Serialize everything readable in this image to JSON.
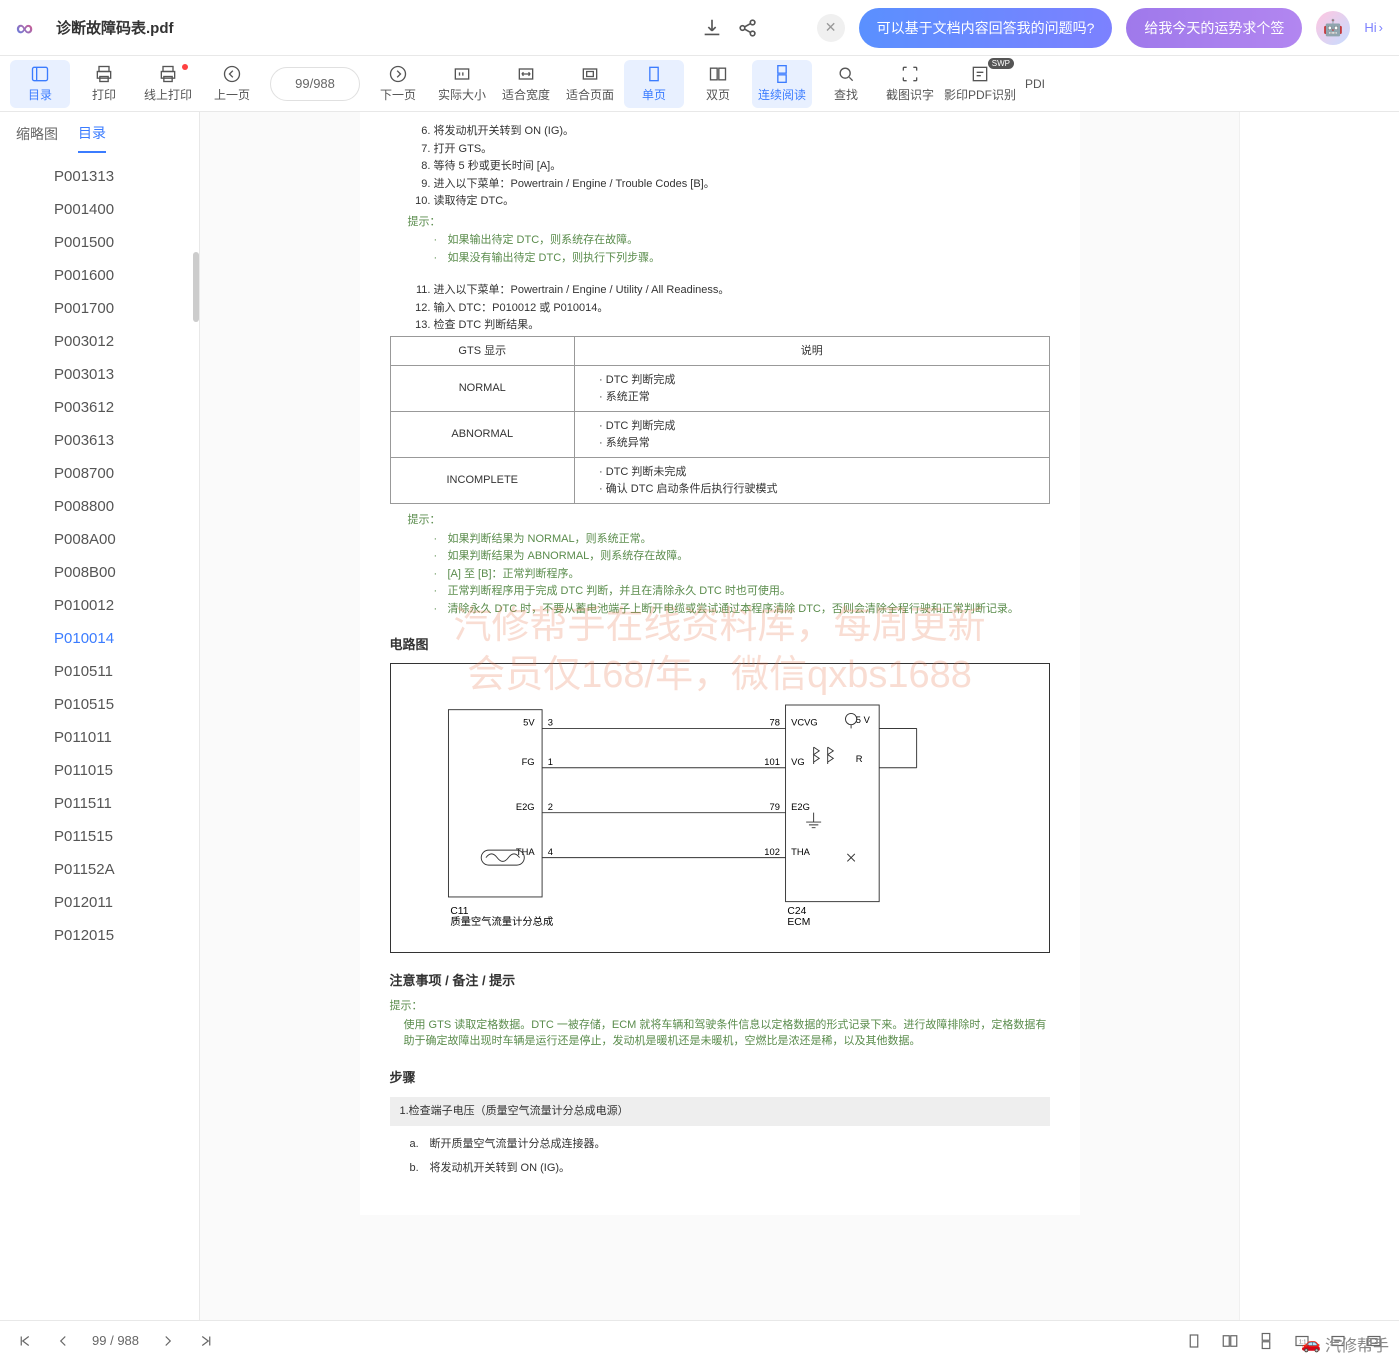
{
  "header": {
    "filename": "诊断故障码表.pdf",
    "pill1": "可以基于文档内容回答我的问题吗?",
    "pill2": "给我今天的运势求个签",
    "hi": "Hi"
  },
  "toolbar": {
    "toc": "目录",
    "print": "打印",
    "online_print": "线上打印",
    "prev": "上一页",
    "page_current": "99",
    "page_sep": " / ",
    "page_total": "988",
    "next": "下一页",
    "actual": "实际大小",
    "fit_width": "适合宽度",
    "fit_page": "适合页面",
    "single": "单页",
    "double": "双页",
    "continuous": "连续阅读",
    "find": "查找",
    "screenshot_ocr": "截图识字",
    "pdf_ocr": "影印PDF识别",
    "pdf_more": "PDI",
    "swp": "SWP"
  },
  "sidebar": {
    "tab_thumb": "缩略图",
    "tab_toc": "目录",
    "items": [
      "P001313",
      "P001400",
      "P001500",
      "P001600",
      "P001700",
      "P003012",
      "P003013",
      "P003612",
      "P003613",
      "P008700",
      "P008800",
      "P008A00",
      "P008B00",
      "P010012",
      "P010014",
      "P010511",
      "P010515",
      "P011011",
      "P011015",
      "P011511",
      "P011515",
      "P01152A",
      "P012011",
      "P012015"
    ],
    "selected_index": 14
  },
  "doc": {
    "pre_lines_start": 6,
    "pre_lines": [
      "将发动机开关转到 ON (IG)。",
      "打开 GTS。",
      "等待 5 秒或更长时间 [A]。",
      "进入以下菜单：Powertrain / Engine / Trouble Codes [B]。",
      "读取待定 DTC。"
    ],
    "hint_label": "提示：",
    "hints1": [
      "如果输出待定 DTC，则系统存在故障。",
      "如果没有输出待定 DTC，则执行下列步骤。"
    ],
    "mid_lines_start": 11,
    "mid_lines": [
      "进入以下菜单：Powertrain / Engine / Utility / All Readiness。",
      "输入 DTC：P010012 或 P010014。",
      "检查 DTC 判断结果。"
    ],
    "table": {
      "head1": "GTS 显示",
      "head2": "说明",
      "rows": [
        {
          "c1": "NORMAL",
          "c2": [
            "DTC 判断完成",
            "系统正常"
          ]
        },
        {
          "c1": "ABNORMAL",
          "c2": [
            "DTC 判断完成",
            "系统异常"
          ]
        },
        {
          "c1": "INCOMPLETE",
          "c2": [
            "DTC 判断未完成",
            "确认 DTC 启动条件后执行行驶模式"
          ]
        }
      ]
    },
    "hints2_label": "提示：",
    "hints2": [
      "如果判断结果为 NORMAL，则系统正常。",
      "如果判断结果为 ABNORMAL，则系统存在故障。",
      "[A] 至 [B]：正常判断程序。",
      "正常判断程序用于完成 DTC 判断，并且在清除永久 DTC 时也可使用。",
      "清除永久 DTC 时，不要从蓄电池端子上断开电缆或尝试通过本程序清除 DTC，否则会清除全程行驶和正常判断记录。"
    ],
    "section_circuit": "电路图",
    "diagram": {
      "left_label": "C11",
      "left_sub": "质量空气流量计分总成",
      "right_label": "C24",
      "right_sub": "ECM",
      "wires": [
        {
          "l": "5V",
          "lp": "3",
          "rp": "78",
          "r": "VCVG",
          "note": "5 V"
        },
        {
          "l": "FG",
          "lp": "1",
          "rp": "101",
          "r": "VG",
          "note": "R"
        },
        {
          "l": "E2G",
          "lp": "2",
          "rp": "79",
          "r": "E2G",
          "note": ""
        },
        {
          "l": "THA",
          "lp": "4",
          "rp": "102",
          "r": "THA",
          "note": ""
        }
      ]
    },
    "watermark_l1": "汽修帮手在线资料库，每周更新",
    "watermark_l2": "会员仅168/年，微信qxbs1688",
    "section_notes": "注意事项 / 备注 / 提示",
    "notes_hint_label": "提示：",
    "notes_hint": "使用 GTS 读取定格数据。DTC 一被存储，ECM 就将车辆和驾驶条件信息以定格数据的形式记录下来。进行故障排除时，定格数据有助于确定故障出现时车辆是运行还是停止，发动机是暖机还是未暖机，空燃比是浓还是稀，以及其他数据。",
    "section_steps": "步骤",
    "step1_title": "1.检查端子电压（质量空气流量计分总成电源）",
    "step_a": "断开质量空气流量计分总成连接器。",
    "step_b": "将发动机开关转到 ON (IG)。"
  },
  "footer": {
    "page_current": "99",
    "page_sep": " / ",
    "page_total": "988",
    "brand": "汽修帮手"
  }
}
